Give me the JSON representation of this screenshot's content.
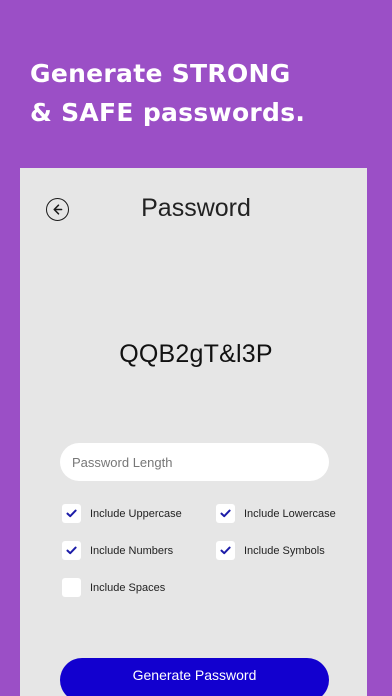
{
  "promo": {
    "line1": "Generate STRONG",
    "line2": "& SAFE passwords."
  },
  "screen": {
    "title": "Password",
    "back_icon": "arrow-left-circle-icon",
    "generated_password": "QQB2gT&l3P",
    "length_input": {
      "placeholder": "Password Length",
      "value": ""
    },
    "options": [
      {
        "label": "Include Uppercase",
        "checked": true
      },
      {
        "label": "Include Lowercase",
        "checked": true
      },
      {
        "label": "Include Numbers",
        "checked": true
      },
      {
        "label": "Include Symbols",
        "checked": true
      },
      {
        "label": "Include Spaces",
        "checked": false
      }
    ],
    "generate_button_label": "Generate Password"
  },
  "colors": {
    "background": "#9b4fc6",
    "panel": "#e6e6e6",
    "accent": "#1200cf",
    "check": "#1c1ca8"
  }
}
